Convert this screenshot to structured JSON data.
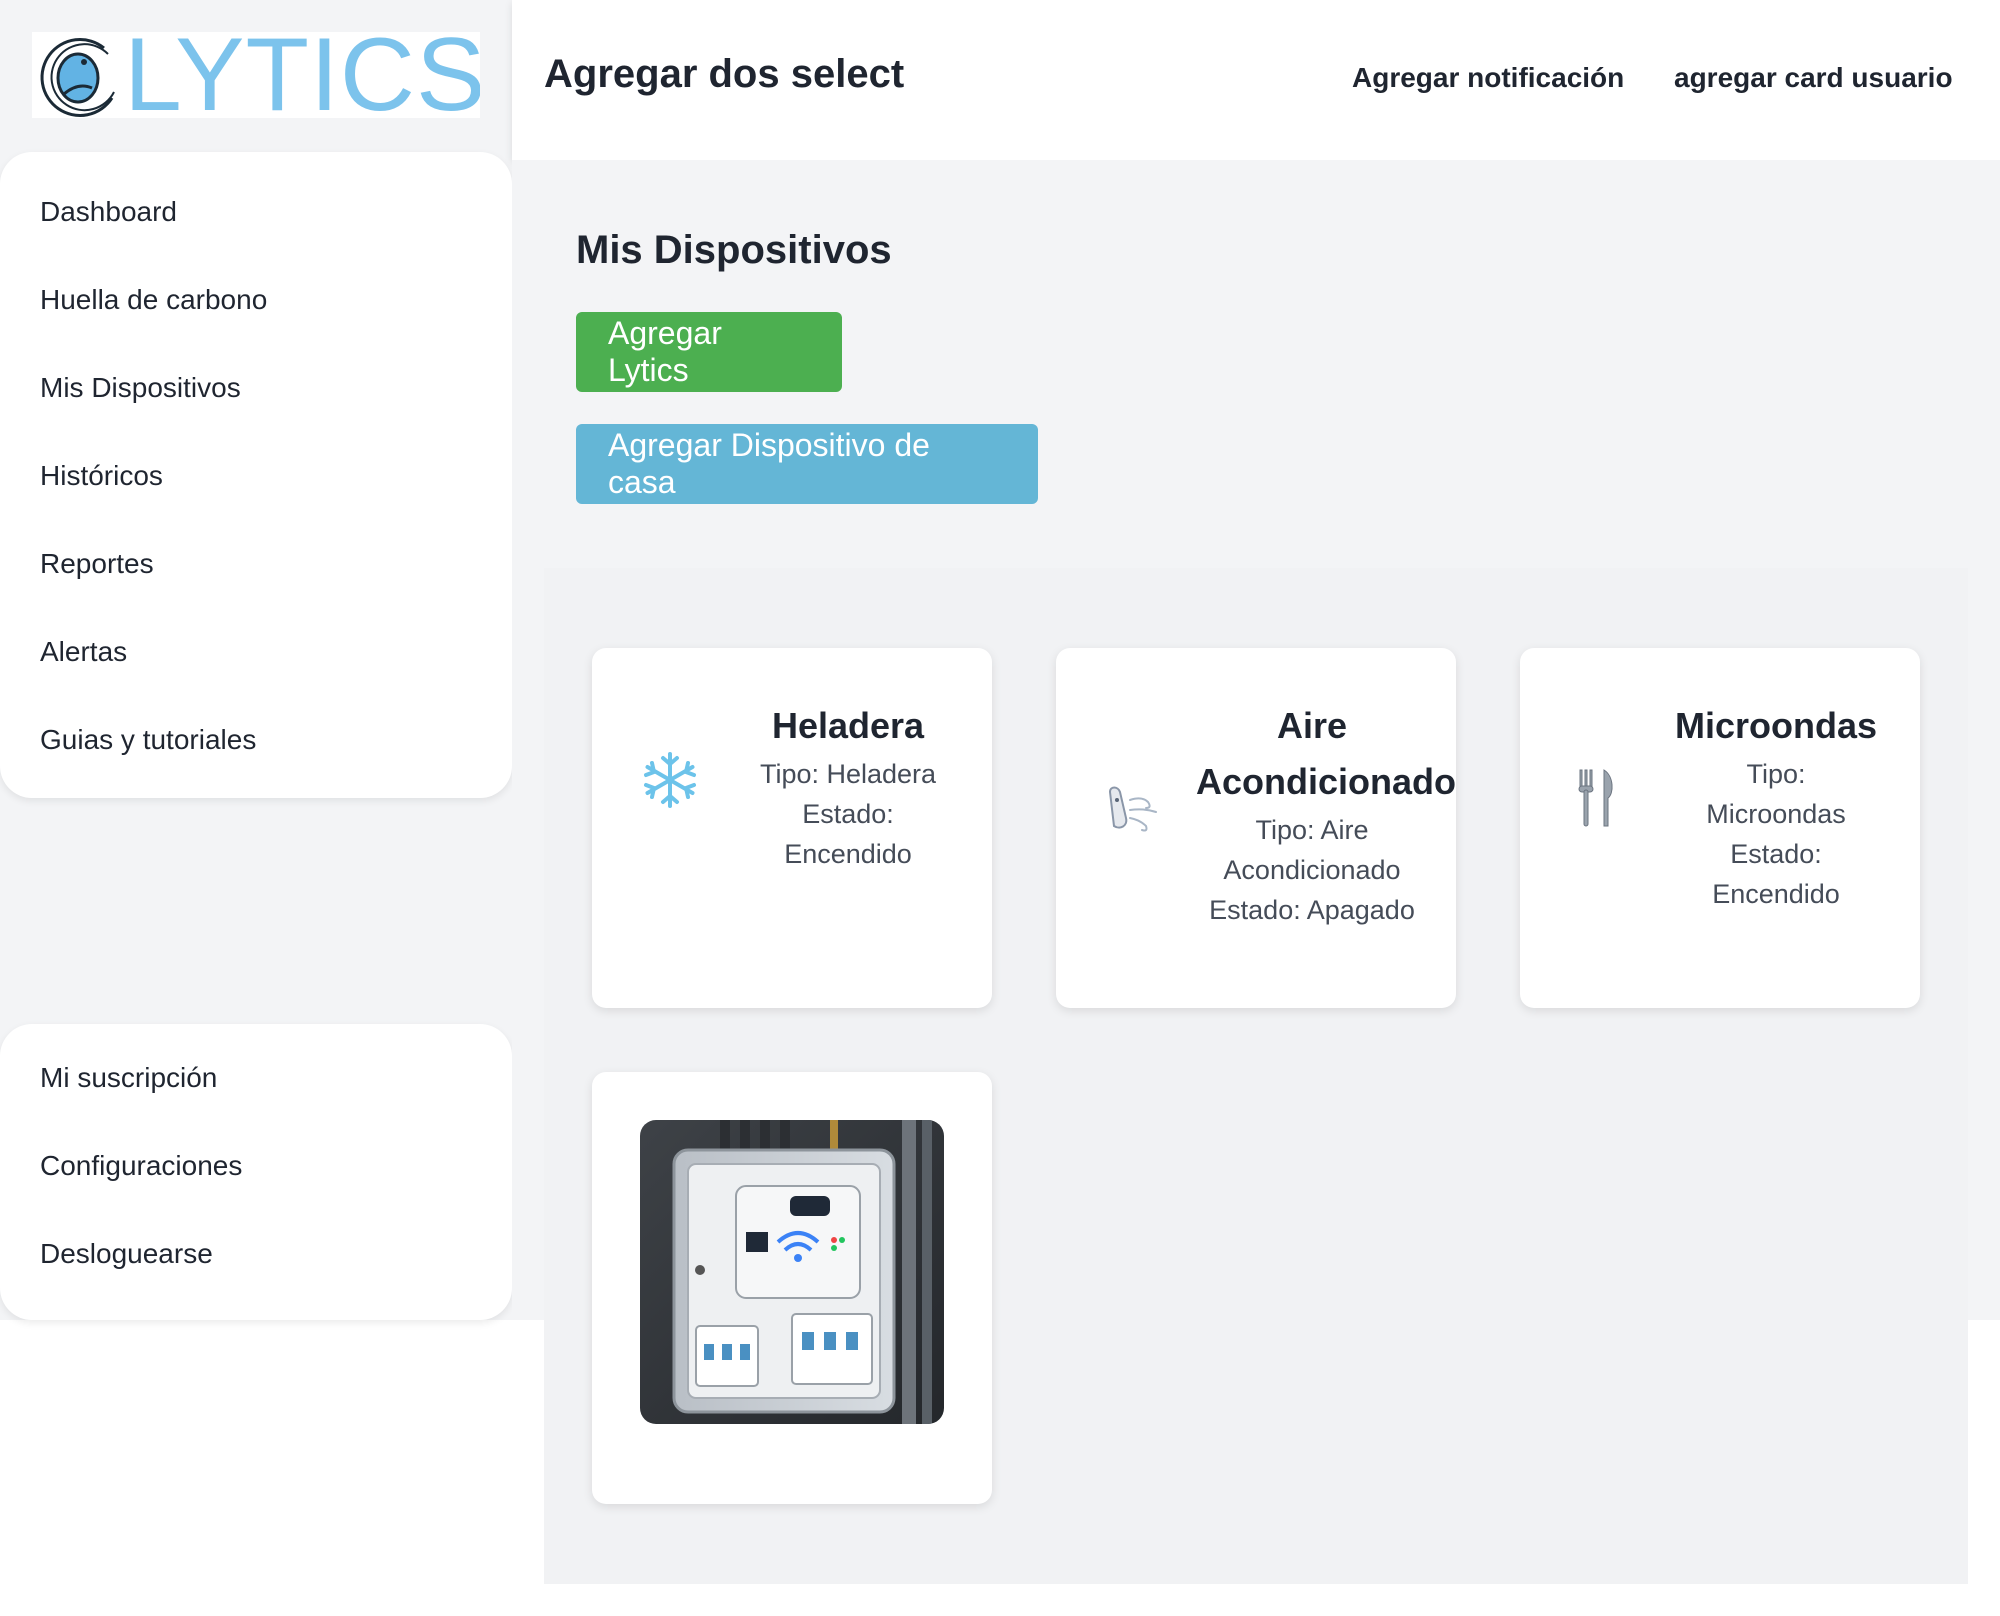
{
  "brand": {
    "logo_text": "LYTICS",
    "accent": "#7cc3ec"
  },
  "sidebar": {
    "primary": [
      {
        "label": "Dashboard"
      },
      {
        "label": "Huella de carbono"
      },
      {
        "label": "Mis Dispositivos"
      },
      {
        "label": "Históricos"
      },
      {
        "label": "Reportes"
      },
      {
        "label": "Alertas"
      },
      {
        "label": "Guias y tutoriales"
      }
    ],
    "secondary": [
      {
        "label": "Mi suscripción"
      },
      {
        "label": "Configuraciones"
      },
      {
        "label": "Desloguearse"
      }
    ]
  },
  "header": {
    "title": "Agregar dos select",
    "links": [
      {
        "label": "Agregar notificación"
      },
      {
        "label": "agregar card usuario"
      }
    ]
  },
  "main": {
    "title": "Mis Dispositivos",
    "buttons": {
      "add_lytics": "Agregar Lytics",
      "add_home_device": "Agregar Dispositivo de casa"
    },
    "colors": {
      "green": "#4caf50",
      "blue": "#64b6d6"
    }
  },
  "devices": [
    {
      "name": "Heladera",
      "icon": "snowflake-icon",
      "lines": [
        "Tipo: Heladera",
        "Estado:",
        "Encendido"
      ]
    },
    {
      "name": "Aire Acondicionado",
      "name_lines": [
        "Aire",
        "Acondicionado"
      ],
      "icon": "wind-icon",
      "lines": [
        "Tipo: Aire",
        "Acondicionado",
        "Estado: Apagado"
      ]
    },
    {
      "name": "Microondas",
      "icon": "fork-knife-icon",
      "lines": [
        "Tipo:",
        "Microondas",
        "Estado:",
        "Encendido"
      ]
    },
    {
      "name": "",
      "icon": "wifi-breaker-box-image"
    }
  ]
}
